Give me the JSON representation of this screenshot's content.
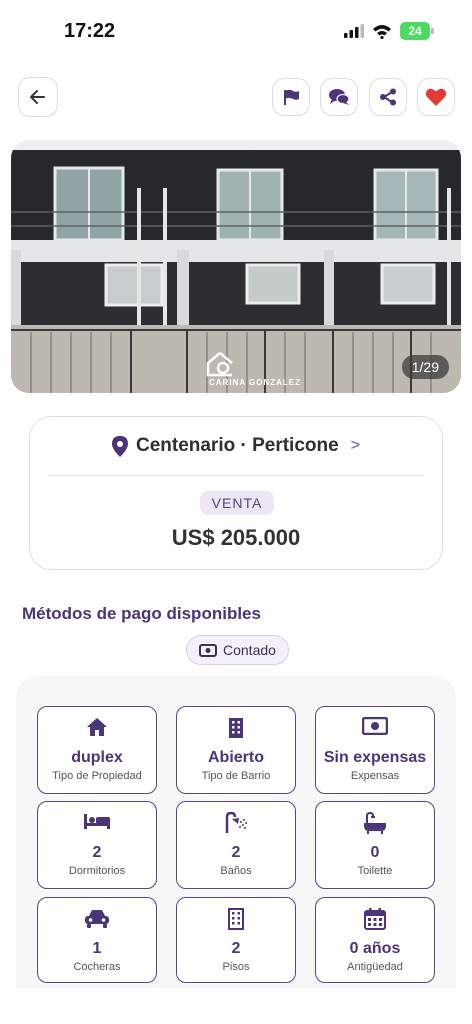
{
  "status_bar": {
    "time": "17:22",
    "battery": "24"
  },
  "gallery": {
    "counter": "1/29",
    "watermark": "CARINA GONZALEZ"
  },
  "listing": {
    "location": "Centenario · Perticone",
    "operation": "VENTA",
    "price": "US$ 205.000"
  },
  "payment": {
    "title": "Métodos de pago disponibles",
    "methods": [
      "Contado"
    ]
  },
  "features": [
    {
      "icon": "house-icon",
      "value": "duplex",
      "label": "Tipo de Propiedad"
    },
    {
      "icon": "building-icon",
      "value": "Abierto",
      "label": "Tipo de Barrio"
    },
    {
      "icon": "money-icon",
      "value": "Sin expensas",
      "label": "Expensas"
    },
    {
      "icon": "bed-icon",
      "value": "2",
      "label": "Dormitorios"
    },
    {
      "icon": "shower-icon",
      "value": "2",
      "label": "Baños"
    },
    {
      "icon": "bathtub-icon",
      "value": "0",
      "label": "Toilette"
    },
    {
      "icon": "car-icon",
      "value": "1",
      "label": "Cocheras"
    },
    {
      "icon": "building-icon",
      "value": "2",
      "label": "Pisos"
    },
    {
      "icon": "calendar-icon",
      "value": "0 años",
      "label": "Antigüedad"
    }
  ],
  "colors": {
    "accent": "#4b3478",
    "favorite": "#e53935",
    "chip_bg": "#ece6f5"
  }
}
